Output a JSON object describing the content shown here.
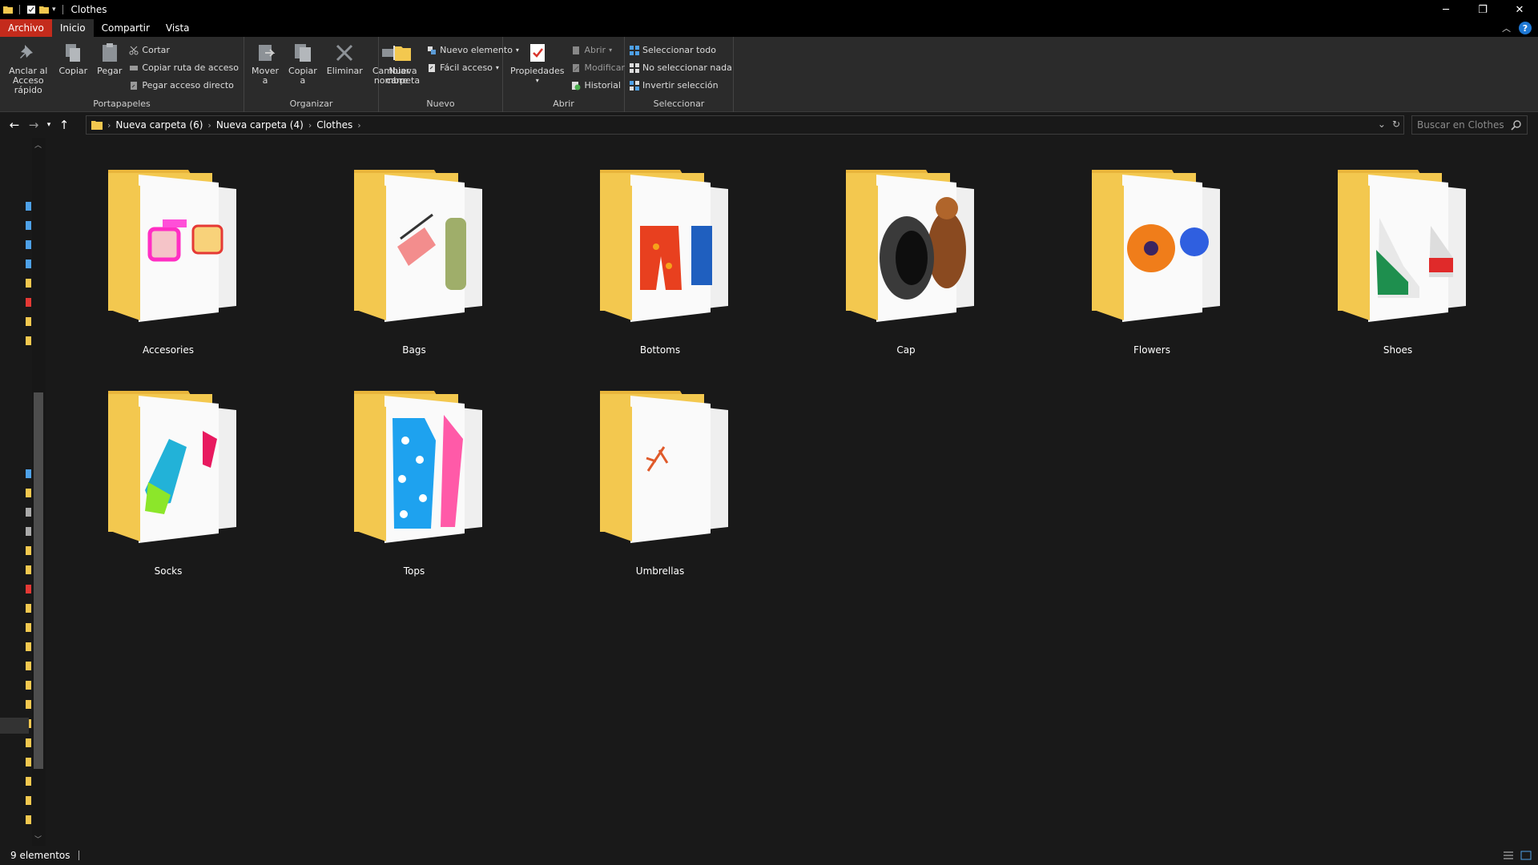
{
  "window": {
    "title": "Clothes",
    "controls": {
      "minimize": "─",
      "restore": "❐",
      "close": "✕"
    }
  },
  "ribbon_tabs": [
    {
      "label": "Archivo"
    },
    {
      "label": "Inicio"
    },
    {
      "label": "Compartir"
    },
    {
      "label": "Vista"
    }
  ],
  "ribbon": {
    "portapapeles": {
      "label": "Portapapeles",
      "pin": "Anclar al\nAcceso rápido",
      "copy": "Copiar",
      "paste": "Pegar",
      "cut": "Cortar",
      "copy_path": "Copiar ruta de acceso",
      "paste_shortcut": "Pegar acceso directo"
    },
    "organizar": {
      "label": "Organizar",
      "move": "Mover\na",
      "copy_to": "Copiar\na",
      "delete": "Eliminar",
      "rename": "Cambiar\nnombre"
    },
    "nuevo": {
      "label": "Nuevo",
      "new_folder": "Nueva\ncarpeta",
      "new_item": "Nuevo elemento",
      "easy_access": "Fácil acceso"
    },
    "abrir": {
      "label": "Abrir",
      "properties": "Propiedades",
      "open": "Abrir",
      "edit": "Modificar",
      "history": "Historial"
    },
    "seleccionar": {
      "label": "Seleccionar",
      "select_all": "Seleccionar todo",
      "select_none": "No seleccionar nada",
      "invert": "Invertir selección"
    }
  },
  "address": {
    "breadcrumbs": [
      "Nueva carpeta (6)",
      "Nueva carpeta (4)",
      "Clothes"
    ],
    "search_placeholder": "Buscar en Clothes"
  },
  "folders": [
    {
      "name": "Accesories",
      "art": "glasses"
    },
    {
      "name": "Bags",
      "art": "bag"
    },
    {
      "name": "Bottoms",
      "art": "shorts"
    },
    {
      "name": "Cap",
      "art": "cap"
    },
    {
      "name": "Flowers",
      "art": "flower"
    },
    {
      "name": "Shoes",
      "art": "shoes"
    },
    {
      "name": "Socks",
      "art": "socks"
    },
    {
      "name": "Tops",
      "art": "tops"
    },
    {
      "name": "Umbrellas",
      "art": "umbrella"
    }
  ],
  "status": {
    "count": "9 elementos"
  },
  "colors": {
    "folder_yellow": "#f3c84f",
    "file_tab": "#c42b1c",
    "background": "#191919",
    "ribbon": "#2b2b2b"
  }
}
